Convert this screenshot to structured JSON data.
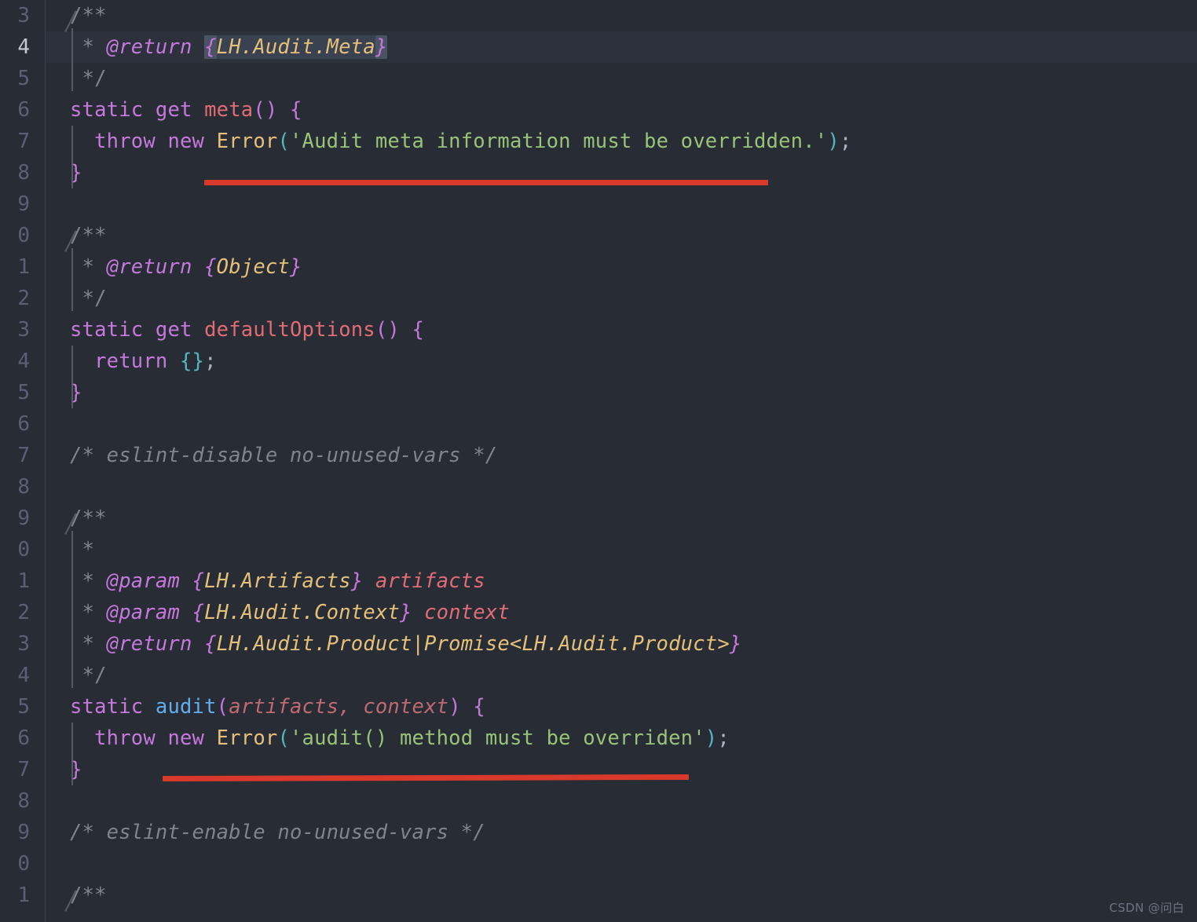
{
  "editor": {
    "theme_name": "one-dark",
    "background": "#282c34",
    "active_line_background": "#2c313c",
    "gutter_background": "#282c34",
    "line_number_color": "#5a6172",
    "active_line_number_color": "#c3c9d4",
    "annotation_color": "#d8392a",
    "language": "javascript"
  },
  "gutter": {
    "line_numbers": [
      "3",
      "4",
      "5",
      "6",
      "7",
      "8",
      "9",
      "0",
      "1",
      "2",
      "3",
      "4",
      "5",
      "6",
      "7",
      "8",
      "9",
      "0",
      "1",
      "2",
      "3",
      "4",
      "5",
      "6",
      "7",
      "8",
      "9",
      "0"
    ],
    "active_index": 1
  },
  "lines": [
    {
      "n": "3",
      "text": "/**"
    },
    {
      "n": "4",
      "text": " * @return {LH.Audit.Meta}"
    },
    {
      "n": "5",
      "text": " */"
    },
    {
      "n": "6",
      "text": "static get meta() {"
    },
    {
      "n": "7",
      "text": "  throw new Error('Audit meta information must be overridden.');"
    },
    {
      "n": "8",
      "text": "}"
    },
    {
      "n": "9",
      "text": ""
    },
    {
      "n": "0",
      "text": "/**"
    },
    {
      "n": "1",
      "text": " * @return {Object}"
    },
    {
      "n": "2",
      "text": " */"
    },
    {
      "n": "3",
      "text": "static get defaultOptions() {"
    },
    {
      "n": "4",
      "text": "  return {};"
    },
    {
      "n": "5",
      "text": "}"
    },
    {
      "n": "6",
      "text": ""
    },
    {
      "n": "7",
      "text": "/* eslint-disable no-unused-vars */"
    },
    {
      "n": "8",
      "text": ""
    },
    {
      "n": "9",
      "text": "/**"
    },
    {
      "n": "0",
      "text": " *"
    },
    {
      "n": "1",
      "text": " * @param {LH.Artifacts} artifacts"
    },
    {
      "n": "2",
      "text": " * @param {LH.Audit.Context} context"
    },
    {
      "n": "3",
      "text": " * @return {LH.Audit.Product|Promise<LH.Audit.Product>}"
    },
    {
      "n": "4",
      "text": " */"
    },
    {
      "n": "5",
      "text": "static audit(artifacts, context) {"
    },
    {
      "n": "6",
      "text": "  throw new Error('audit() method must be overriden');"
    },
    {
      "n": "7",
      "text": "}"
    },
    {
      "n": "8",
      "text": ""
    },
    {
      "n": "9",
      "text": "/* eslint-enable no-unused-vars */"
    },
    {
      "n": "0",
      "text": ""
    },
    {
      "n": "1",
      "text": "/**"
    }
  ],
  "tokens": {
    "comment_open": "/**",
    "comment_close": " */",
    "comment_star": " *",
    "jsdoc_return": "@return",
    "jsdoc_param": "@param",
    "type_meta": "LH.Audit.Meta",
    "type_object": "Object",
    "type_artifacts": "LH.Artifacts",
    "type_context": "LH.Audit.Context",
    "type_product": "LH.Audit.Product|Promise<LH.Audit.Product>",
    "pname_artifacts": "artifacts",
    "pname_context": "context",
    "kw_static": "static",
    "kw_get": "get",
    "kw_throw": "throw",
    "kw_new": "new",
    "kw_return": "return",
    "fn_meta": "meta",
    "fn_defaultOptions": "defaultOptions",
    "fn_audit": "audit",
    "cls_error": "Error",
    "arg_artifacts": "artifacts",
    "arg_context": "context",
    "str_meta_error": "'Audit meta information must be overridden.'",
    "str_audit_error": "'audit() method must be overriden'",
    "comment_eslint_disable": "/* eslint-disable no-unused-vars */",
    "comment_eslint_enable": "/* eslint-enable no-unused-vars */",
    "brace_open": "{",
    "brace_close": "}",
    "paren_open": "(",
    "paren_close": ")",
    "paren_pair": "()",
    "brace_pair": "{}",
    "semicolon": ";",
    "comma": ",",
    "space": " "
  },
  "annotations": [
    {
      "id": "underline-meta-throw",
      "label": "red-underline",
      "color": "#d8392a"
    },
    {
      "id": "underline-audit-throw",
      "label": "red-underline",
      "color": "#d8392a"
    }
  ],
  "watermark": {
    "text": "CSDN @问白"
  }
}
